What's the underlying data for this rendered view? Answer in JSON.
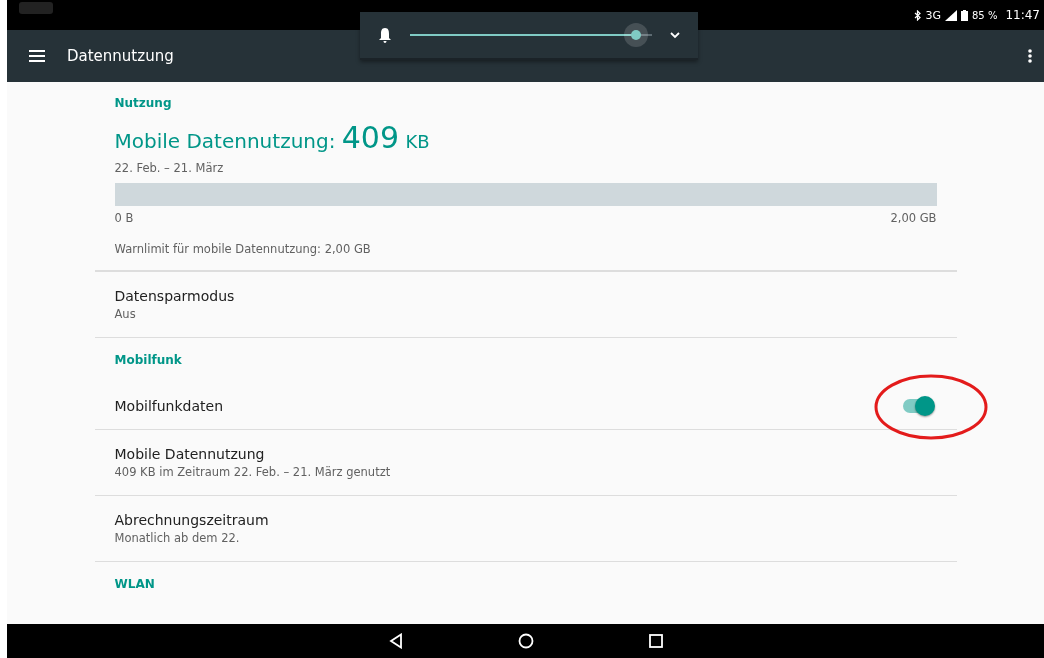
{
  "status_bar": {
    "network": "3G",
    "battery": "85 %",
    "time": "11:47"
  },
  "toolbar": {
    "title": "Datennutzung"
  },
  "volume_popup": {
    "level": 0.98
  },
  "usage": {
    "header": "Nutzung",
    "label": "Mobile Datennutzung:",
    "amount": "409",
    "unit": "KB",
    "period": "22. Feb. – 21. März",
    "min_label": "0 B",
    "max_label": "2,00 GB",
    "warning": "Warnlimit für mobile Datennutzung: 2,00 GB"
  },
  "rows": [
    {
      "kind": "item",
      "title": "Datensparmodus",
      "subtitle": "Aus"
    },
    {
      "kind": "header",
      "title": "Mobilfunk"
    },
    {
      "kind": "toggle",
      "title": "Mobilfunkdaten",
      "on": true
    },
    {
      "kind": "item",
      "title": "Mobile Datennutzung",
      "subtitle": "409 KB im Zeitraum 22. Feb. – 21. März genutzt"
    },
    {
      "kind": "item",
      "title": "Abrechnungszeitraum",
      "subtitle": "Monatlich ab dem 22."
    },
    {
      "kind": "header",
      "title": "WLAN"
    }
  ]
}
